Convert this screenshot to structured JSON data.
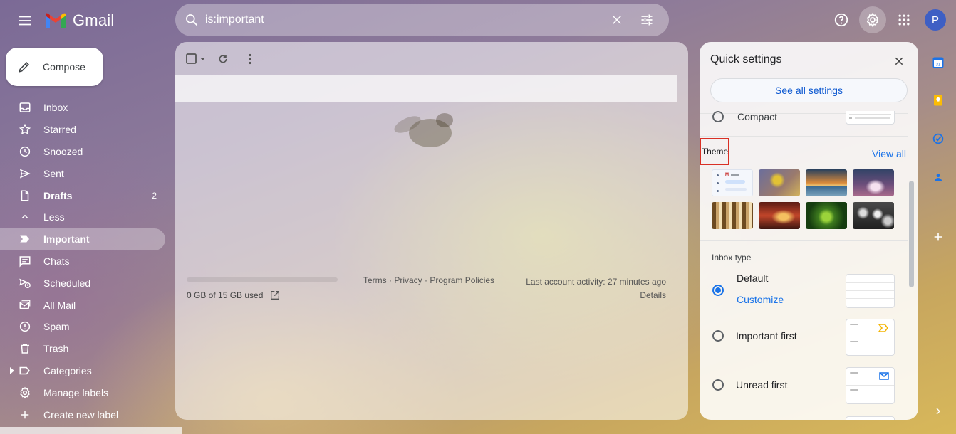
{
  "header": {
    "app_name": "Gmail",
    "search_value": "is:important",
    "avatar_initial": "P",
    "icons": [
      "menu-icon",
      "search-icon",
      "clear-search-icon",
      "search-options-icon",
      "help-icon",
      "settings-icon",
      "apps-icon"
    ]
  },
  "compose": {
    "label": "Compose",
    "icon": "pencil-icon"
  },
  "nav": {
    "items": [
      {
        "label": "Inbox",
        "icon": "inbox-icon",
        "count": ""
      },
      {
        "label": "Starred",
        "icon": "star-icon",
        "count": ""
      },
      {
        "label": "Snoozed",
        "icon": "clock-icon",
        "count": ""
      },
      {
        "label": "Sent",
        "icon": "send-icon",
        "count": ""
      },
      {
        "label": "Drafts",
        "icon": "draft-icon",
        "count": "2"
      },
      {
        "label": "Less",
        "icon": "chevron-up-icon",
        "count": ""
      },
      {
        "label": "Important",
        "icon": "important-icon",
        "count": ""
      },
      {
        "label": "Chats",
        "icon": "chat-icon",
        "count": ""
      },
      {
        "label": "Scheduled",
        "icon": "scheduled-icon",
        "count": ""
      },
      {
        "label": "All Mail",
        "icon": "all-mail-icon",
        "count": ""
      },
      {
        "label": "Spam",
        "icon": "spam-icon",
        "count": ""
      },
      {
        "label": "Trash",
        "icon": "trash-icon",
        "count": ""
      },
      {
        "label": "Categories",
        "icon": "label-icon",
        "count": ""
      },
      {
        "label": "Manage labels",
        "icon": "gear-icon",
        "count": ""
      },
      {
        "label": "Create new label",
        "icon": "plus-icon",
        "count": ""
      }
    ],
    "active": "Important"
  },
  "main": {
    "storage_text": "0 GB of 15 GB used",
    "storage_used_fraction": 0,
    "footer_terms": "Terms",
    "footer_privacy": "Privacy",
    "footer_policies": "Program Policies",
    "footer_sep": " · ",
    "last_activity": "Last account activity: 27 minutes ago",
    "details": "Details"
  },
  "quick_settings": {
    "title": "Quick settings",
    "see_all": "See all settings",
    "density_option": "Compact",
    "theme_label": "Theme",
    "view_all": "View all",
    "themes": [
      "default",
      "bee",
      "beach",
      "night-sky",
      "chess",
      "canyon",
      "leaf",
      "bubbles"
    ],
    "inbox_type_title": "Inbox type",
    "inbox_types": [
      {
        "label": "Default",
        "selected": true
      },
      {
        "label": "Important first",
        "selected": false
      },
      {
        "label": "Unread first",
        "selected": false
      }
    ],
    "customize": "Customize"
  },
  "colors": {
    "accent": "#1a73e8",
    "highlight_border": "#d93025",
    "avatar_bg": "#3e5fc4"
  }
}
